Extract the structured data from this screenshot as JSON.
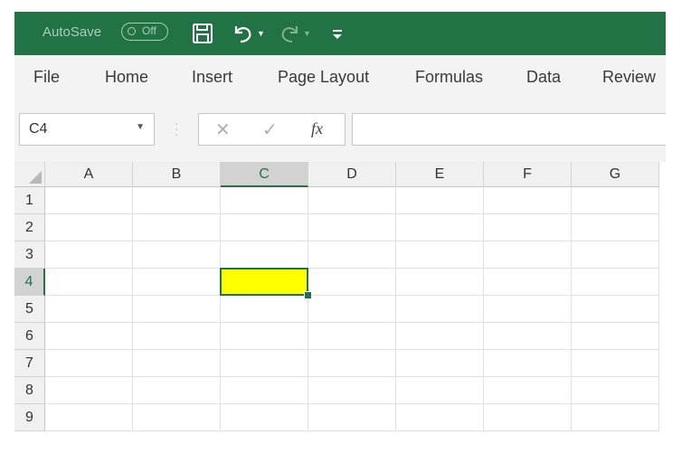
{
  "titlebar": {
    "autosave_label": "AutoSave",
    "autosave_state": "Off",
    "bg_color": "#217346",
    "icons": [
      "save-icon",
      "undo-icon",
      "redo-icon",
      "customize-quick-access-icon"
    ]
  },
  "ribbon": {
    "tabs": [
      "File",
      "Home",
      "Insert",
      "Page Layout",
      "Formulas",
      "Data",
      "Review"
    ]
  },
  "formula_bar": {
    "name_box": "C4",
    "formula_value": "",
    "fx_label": "fx"
  },
  "sheet": {
    "columns": [
      "A",
      "B",
      "C",
      "D",
      "E",
      "F",
      "G"
    ],
    "rows": [
      "1",
      "2",
      "3",
      "4",
      "5",
      "6",
      "7",
      "8",
      "9"
    ],
    "active_cell": "C4",
    "active_cell_fill": "#ffff00",
    "accent_color": "#217346"
  }
}
